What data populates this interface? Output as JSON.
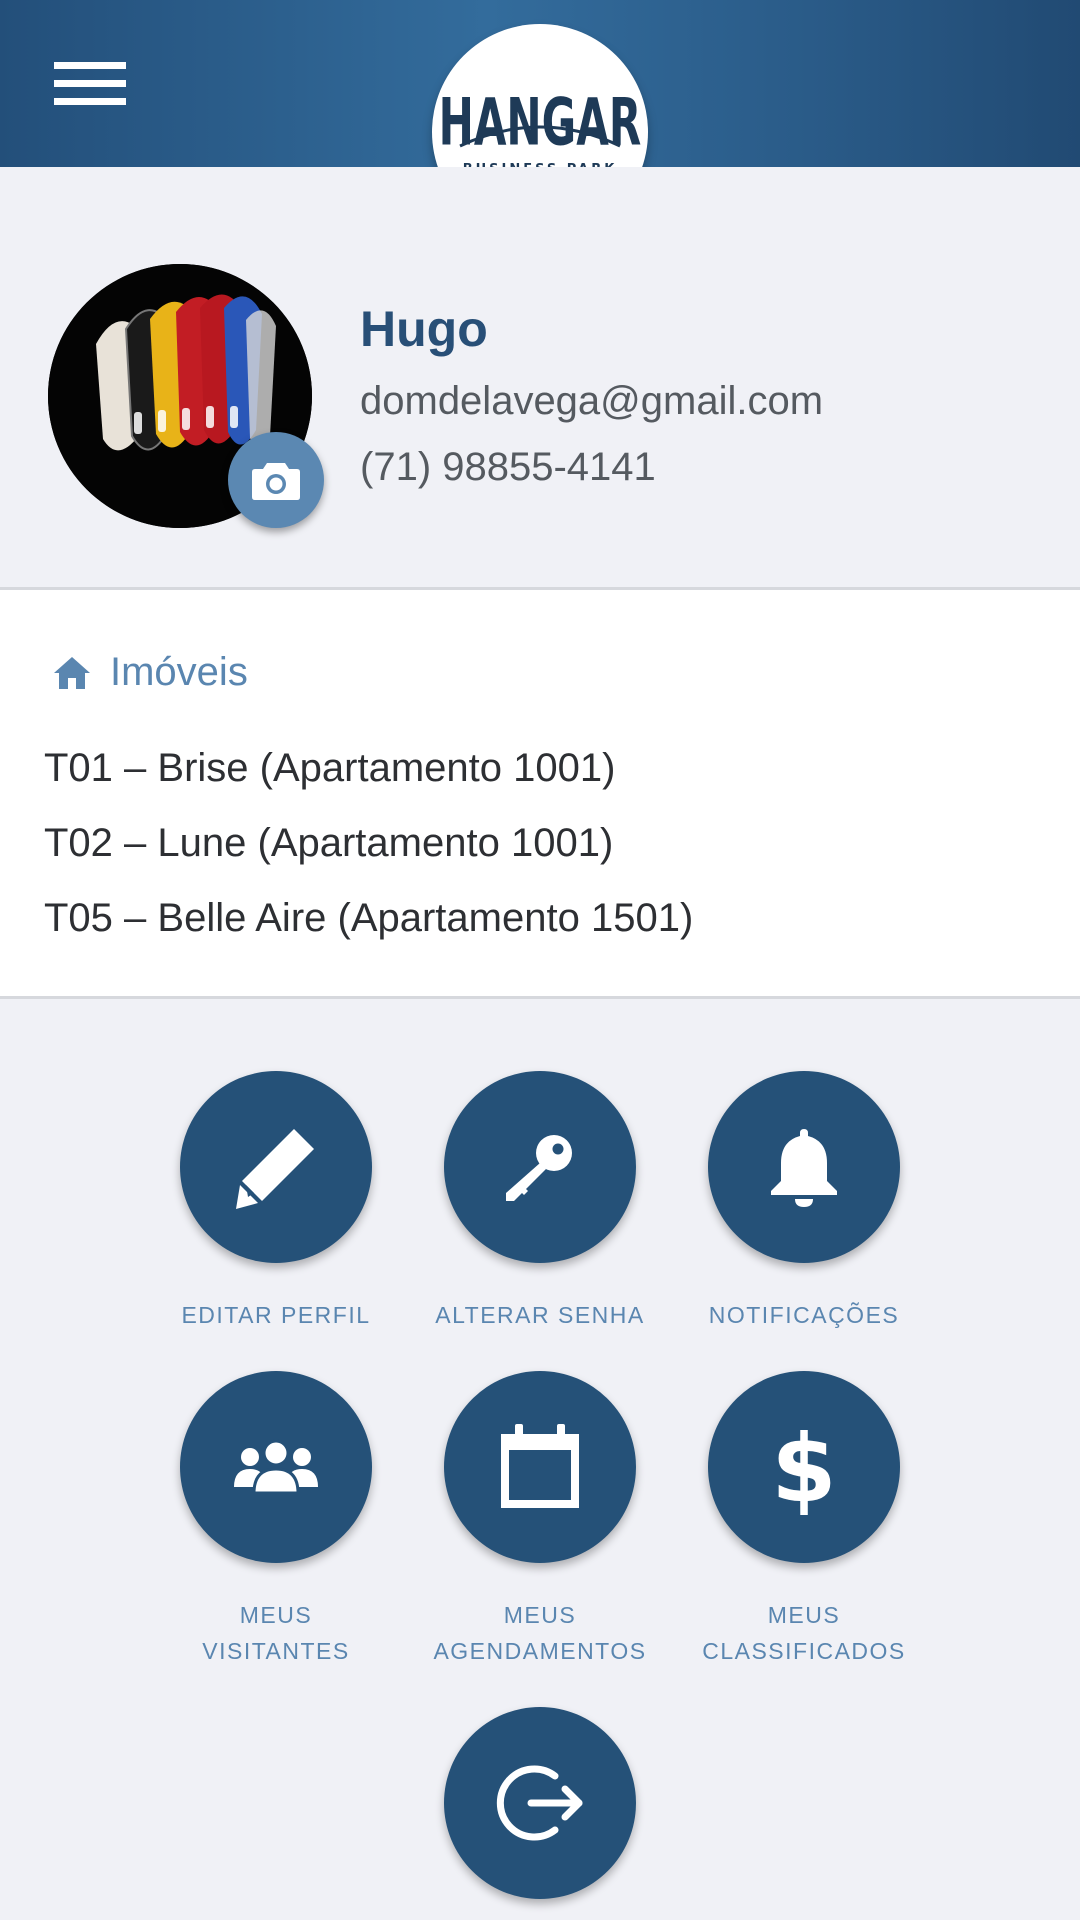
{
  "header": {
    "logo_title": "HANGAR",
    "logo_subtitle": "BUSINESS PARK"
  },
  "profile": {
    "name": "Hugo",
    "email": "domdelavega@gmail.com",
    "phone": "(71) 98855-4141"
  },
  "properties": {
    "title": "Imóveis",
    "items": [
      "T01 – Brise (Apartamento 1001)",
      "T02 – Lune (Apartamento 1001)",
      "T05 – Belle Aire (Apartamento 1501)"
    ]
  },
  "actions": [
    {
      "icon": "pencil-icon",
      "line1": "EDITAR PERFIL",
      "line2": ""
    },
    {
      "icon": "key-icon",
      "line1": "ALTERAR SENHA",
      "line2": ""
    },
    {
      "icon": "bell-icon",
      "line1": "NOTIFICAÇÕES",
      "line2": ""
    },
    {
      "icon": "visitors-icon",
      "line1": "MEUS",
      "line2": "VISITANTES"
    },
    {
      "icon": "calendar-icon",
      "line1": "MEUS",
      "line2": "AGENDAMENTOS"
    },
    {
      "icon": "dollar-icon",
      "line1": "MEUS",
      "line2": "CLASSIFICADOS"
    },
    {
      "icon": "logout-icon",
      "line1": "",
      "line2": ""
    }
  ],
  "colors": {
    "header": "#2a5b88",
    "action_circle": "#255178",
    "accent_text": "#5a86b0",
    "name_text": "#284f77",
    "background": "#f0f1f6"
  }
}
